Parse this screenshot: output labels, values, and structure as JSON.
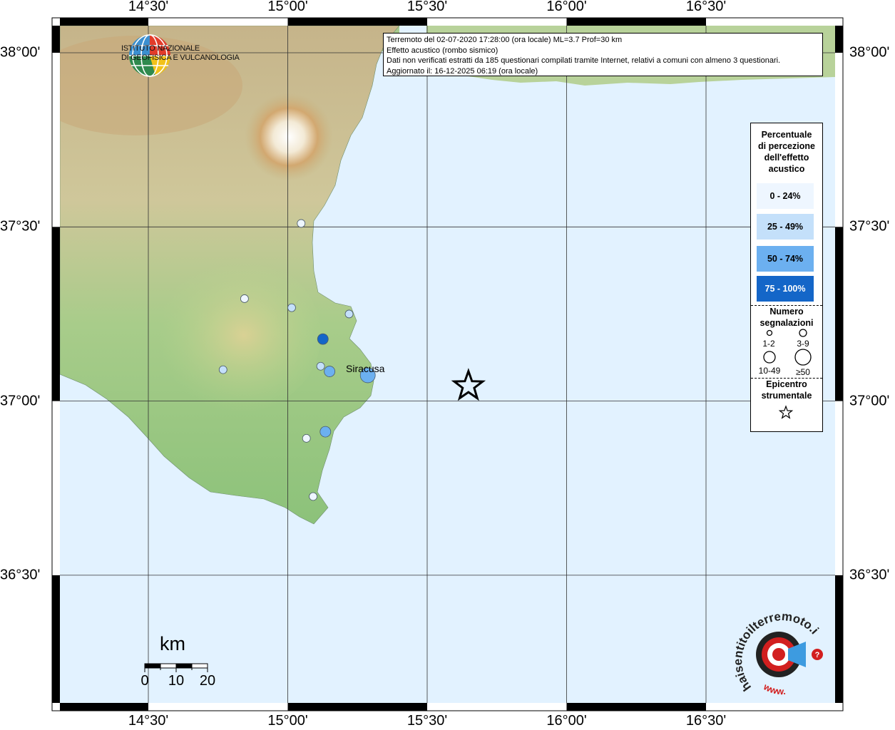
{
  "map": {
    "longitude_labels": [
      "14°30'",
      "15°00'",
      "15°30'",
      "16°00'",
      "16°30'"
    ],
    "latitude_labels": [
      "38°00'",
      "37°30'",
      "37°00'",
      "36°30'"
    ],
    "place_label": "Siracusa",
    "colors": {
      "sea": "#e2f2ff",
      "class_0_24": "#eef6ff",
      "class_25_49": "#c4e0fa",
      "class_50_74": "#6cb0f0",
      "class_75_100": "#1466c8"
    }
  },
  "logos": {
    "ingv_line1": "ISTITUTO NAZIONALE",
    "ingv_line2": "DI GEOFISICA E VULCANOLOGIA",
    "hst_text": "haisentitoilterremoto.it",
    "hst_www": "www."
  },
  "info": {
    "line1": "Terremoto del 02-07-2020 17:28:00 (ora locale) ML=3.7 Prof=30 km",
    "line2": "Effetto acustico (rombo sismico)",
    "line3": "Dati non verificati estratti da 185 questionari compilati tramite Internet, relativi a comuni con almeno 3 questionari.",
    "line4": "Aggiornato il: 16-12-2025 06:19 (ora locale)"
  },
  "legend": {
    "title_lines": [
      "Percentuale",
      "di percezione",
      "dell'effetto",
      "acustico"
    ],
    "classes": [
      "0 - 24%",
      "25 - 49%",
      "50 - 74%",
      "75 - 100%"
    ],
    "count_title_lines": [
      "Numero",
      "segnalazioni"
    ],
    "counts": [
      "1-2",
      "3-9",
      "10-49",
      "≥50"
    ],
    "epicenter_lines": [
      "Epicentro",
      "strumentale"
    ]
  },
  "scale": {
    "unit": "km",
    "ticks": [
      "0",
      "10",
      "20"
    ]
  },
  "observations": [
    {
      "lon": 15.048,
      "lat": 37.51,
      "pct_class": 0,
      "count_class": 1
    },
    {
      "lon": 14.845,
      "lat": 37.294,
      "pct_class": 0,
      "count_class": 1
    },
    {
      "lon": 15.014,
      "lat": 37.268,
      "pct_class": 1,
      "count_class": 1
    },
    {
      "lon": 15.22,
      "lat": 37.25,
      "pct_class": 1,
      "count_class": 1
    },
    {
      "lon": 15.126,
      "lat": 37.178,
      "pct_class": 3,
      "count_class": 2
    },
    {
      "lon": 15.118,
      "lat": 37.1,
      "pct_class": 1,
      "count_class": 1
    },
    {
      "lon": 15.15,
      "lat": 37.085,
      "pct_class": 2,
      "count_class": 2
    },
    {
      "lon": 15.287,
      "lat": 37.074,
      "pct_class": 2,
      "count_class": 3
    },
    {
      "lon": 14.768,
      "lat": 37.09,
      "pct_class": 1,
      "count_class": 1
    },
    {
      "lon": 15.135,
      "lat": 36.912,
      "pct_class": 2,
      "count_class": 2
    },
    {
      "lon": 15.067,
      "lat": 36.893,
      "pct_class": 0,
      "count_class": 1
    },
    {
      "lon": 15.091,
      "lat": 36.726,
      "pct_class": 0,
      "count_class": 1
    }
  ],
  "epicenter": {
    "lon": 15.648,
    "lat": 37.043
  }
}
